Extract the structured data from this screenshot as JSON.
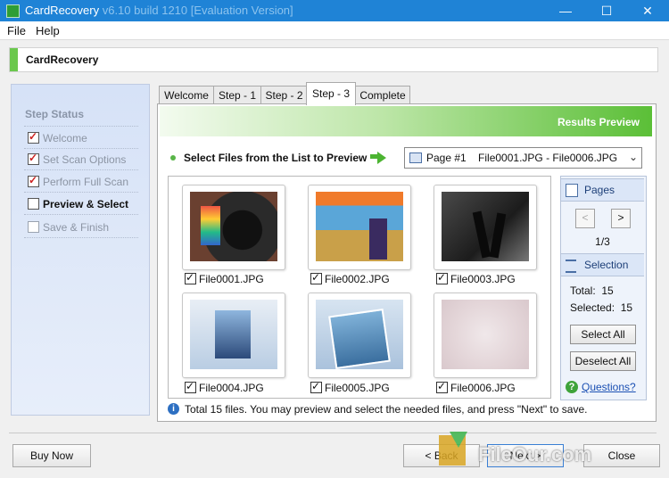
{
  "window": {
    "title_main": "CardRecovery",
    "title_extra": "v6.10 build 1210 [Evaluation Version]",
    "minimize": "—",
    "maximize": "☐",
    "close": "✕"
  },
  "menu": {
    "items": [
      "File",
      "Help"
    ]
  },
  "header": {
    "title": "CardRecovery"
  },
  "step_status": {
    "title": "Step Status",
    "items": [
      {
        "label": "Welcome",
        "checked": true,
        "current": false
      },
      {
        "label": "Set Scan Options",
        "checked": true,
        "current": false
      },
      {
        "label": "Perform Full Scan",
        "checked": true,
        "current": false
      },
      {
        "label": "Preview & Select",
        "checked": false,
        "current": true
      },
      {
        "label": "Save & Finish",
        "checked": false,
        "current": false
      }
    ]
  },
  "tabs": [
    "Welcome",
    "Step - 1",
    "Step - 2",
    "Step - 3",
    "Complete"
  ],
  "active_tab": "Step - 3",
  "results": {
    "banner": "Results Preview",
    "instruction": "Select Files from the List to Preview",
    "page_select": "Page #1    File0001.JPG - File0006.JPG",
    "files": [
      "File0001.JPG",
      "File0002.JPG",
      "File0003.JPG",
      "File0004.JPG",
      "File0005.JPG",
      "File0006.JPG"
    ],
    "status_text": "Total 15 files.  You may preview and select the needed files, and press \"Next\" to save."
  },
  "side_panel": {
    "pages_label": "Pages",
    "prev": "<",
    "next": ">",
    "page_indicator": "1/3",
    "selection_label": "Selection",
    "total": "Total:  15",
    "selected": "Selected:  15",
    "select_all": "Select All",
    "deselect_all": "Deselect All",
    "questions": "Questions?"
  },
  "bottom": {
    "buy_now": "Buy Now",
    "back": "< Back",
    "next": "Next >",
    "close": "Close"
  },
  "watermark": "FileOur.com",
  "colors": {
    "titlebar": "#1f83d6",
    "accent_green": "#5bbf37",
    "link": "#1a4fb3"
  }
}
